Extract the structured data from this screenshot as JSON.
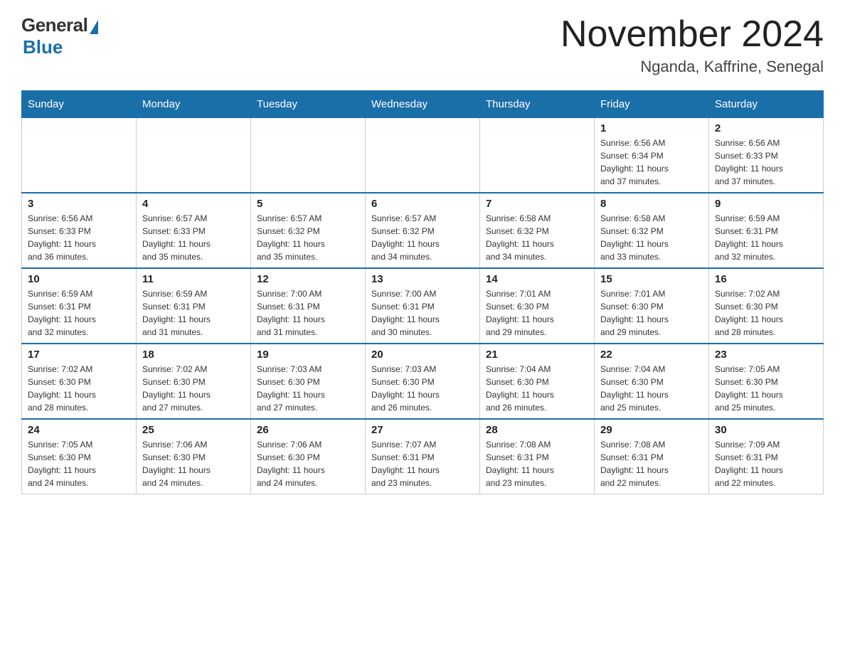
{
  "header": {
    "logo_general": "General",
    "logo_blue": "Blue",
    "title": "November 2024",
    "location": "Nganda, Kaffrine, Senegal"
  },
  "weekdays": [
    "Sunday",
    "Monday",
    "Tuesday",
    "Wednesday",
    "Thursday",
    "Friday",
    "Saturday"
  ],
  "weeks": [
    [
      {
        "day": "",
        "info": ""
      },
      {
        "day": "",
        "info": ""
      },
      {
        "day": "",
        "info": ""
      },
      {
        "day": "",
        "info": ""
      },
      {
        "day": "",
        "info": ""
      },
      {
        "day": "1",
        "info": "Sunrise: 6:56 AM\nSunset: 6:34 PM\nDaylight: 11 hours\nand 37 minutes."
      },
      {
        "day": "2",
        "info": "Sunrise: 6:56 AM\nSunset: 6:33 PM\nDaylight: 11 hours\nand 37 minutes."
      }
    ],
    [
      {
        "day": "3",
        "info": "Sunrise: 6:56 AM\nSunset: 6:33 PM\nDaylight: 11 hours\nand 36 minutes."
      },
      {
        "day": "4",
        "info": "Sunrise: 6:57 AM\nSunset: 6:33 PM\nDaylight: 11 hours\nand 35 minutes."
      },
      {
        "day": "5",
        "info": "Sunrise: 6:57 AM\nSunset: 6:32 PM\nDaylight: 11 hours\nand 35 minutes."
      },
      {
        "day": "6",
        "info": "Sunrise: 6:57 AM\nSunset: 6:32 PM\nDaylight: 11 hours\nand 34 minutes."
      },
      {
        "day": "7",
        "info": "Sunrise: 6:58 AM\nSunset: 6:32 PM\nDaylight: 11 hours\nand 34 minutes."
      },
      {
        "day": "8",
        "info": "Sunrise: 6:58 AM\nSunset: 6:32 PM\nDaylight: 11 hours\nand 33 minutes."
      },
      {
        "day": "9",
        "info": "Sunrise: 6:59 AM\nSunset: 6:31 PM\nDaylight: 11 hours\nand 32 minutes."
      }
    ],
    [
      {
        "day": "10",
        "info": "Sunrise: 6:59 AM\nSunset: 6:31 PM\nDaylight: 11 hours\nand 32 minutes."
      },
      {
        "day": "11",
        "info": "Sunrise: 6:59 AM\nSunset: 6:31 PM\nDaylight: 11 hours\nand 31 minutes."
      },
      {
        "day": "12",
        "info": "Sunrise: 7:00 AM\nSunset: 6:31 PM\nDaylight: 11 hours\nand 31 minutes."
      },
      {
        "day": "13",
        "info": "Sunrise: 7:00 AM\nSunset: 6:31 PM\nDaylight: 11 hours\nand 30 minutes."
      },
      {
        "day": "14",
        "info": "Sunrise: 7:01 AM\nSunset: 6:30 PM\nDaylight: 11 hours\nand 29 minutes."
      },
      {
        "day": "15",
        "info": "Sunrise: 7:01 AM\nSunset: 6:30 PM\nDaylight: 11 hours\nand 29 minutes."
      },
      {
        "day": "16",
        "info": "Sunrise: 7:02 AM\nSunset: 6:30 PM\nDaylight: 11 hours\nand 28 minutes."
      }
    ],
    [
      {
        "day": "17",
        "info": "Sunrise: 7:02 AM\nSunset: 6:30 PM\nDaylight: 11 hours\nand 28 minutes."
      },
      {
        "day": "18",
        "info": "Sunrise: 7:02 AM\nSunset: 6:30 PM\nDaylight: 11 hours\nand 27 minutes."
      },
      {
        "day": "19",
        "info": "Sunrise: 7:03 AM\nSunset: 6:30 PM\nDaylight: 11 hours\nand 27 minutes."
      },
      {
        "day": "20",
        "info": "Sunrise: 7:03 AM\nSunset: 6:30 PM\nDaylight: 11 hours\nand 26 minutes."
      },
      {
        "day": "21",
        "info": "Sunrise: 7:04 AM\nSunset: 6:30 PM\nDaylight: 11 hours\nand 26 minutes."
      },
      {
        "day": "22",
        "info": "Sunrise: 7:04 AM\nSunset: 6:30 PM\nDaylight: 11 hours\nand 25 minutes."
      },
      {
        "day": "23",
        "info": "Sunrise: 7:05 AM\nSunset: 6:30 PM\nDaylight: 11 hours\nand 25 minutes."
      }
    ],
    [
      {
        "day": "24",
        "info": "Sunrise: 7:05 AM\nSunset: 6:30 PM\nDaylight: 11 hours\nand 24 minutes."
      },
      {
        "day": "25",
        "info": "Sunrise: 7:06 AM\nSunset: 6:30 PM\nDaylight: 11 hours\nand 24 minutes."
      },
      {
        "day": "26",
        "info": "Sunrise: 7:06 AM\nSunset: 6:30 PM\nDaylight: 11 hours\nand 24 minutes."
      },
      {
        "day": "27",
        "info": "Sunrise: 7:07 AM\nSunset: 6:31 PM\nDaylight: 11 hours\nand 23 minutes."
      },
      {
        "day": "28",
        "info": "Sunrise: 7:08 AM\nSunset: 6:31 PM\nDaylight: 11 hours\nand 23 minutes."
      },
      {
        "day": "29",
        "info": "Sunrise: 7:08 AM\nSunset: 6:31 PM\nDaylight: 11 hours\nand 22 minutes."
      },
      {
        "day": "30",
        "info": "Sunrise: 7:09 AM\nSunset: 6:31 PM\nDaylight: 11 hours\nand 22 minutes."
      }
    ]
  ]
}
